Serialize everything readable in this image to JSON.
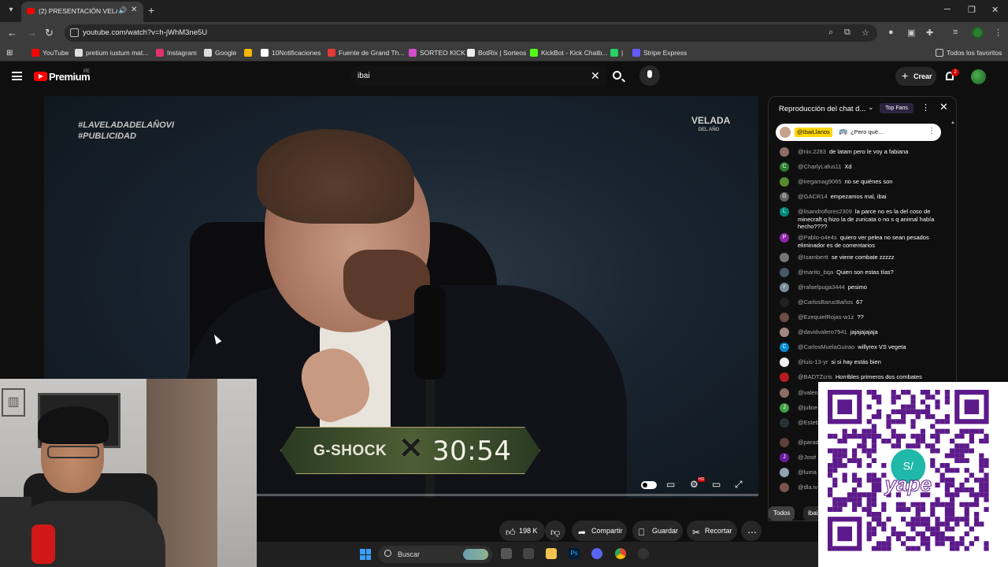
{
  "browser": {
    "tab_title": "(2) PRESENTACIÓN VELADA...",
    "url": "youtube.com/watch?v=h-jWhM3ne5U",
    "bookmarks": [
      {
        "label": "YouTube",
        "color": "#ff0000"
      },
      {
        "label": "pretium iustum mat...",
        "color": "#dddddd"
      },
      {
        "label": "Instagram",
        "color": "#e1306c"
      },
      {
        "label": "Google",
        "color": "#dddddd"
      },
      {
        "label": "",
        "color": "#f4b400"
      },
      {
        "label": "10Notificaciones",
        "color": "#ffffff"
      },
      {
        "label": "Fuente de Grand Th...",
        "color": "#e53935"
      },
      {
        "label": "SORTEO KICK",
        "color": "#d34dc9"
      },
      {
        "label": "BotRix | Sorteos",
        "color": "#eeeeee"
      },
      {
        "label": "KickBot - Kick Chatb...",
        "color": "#53fc18"
      },
      {
        "label": "|",
        "color": "#25d366"
      },
      {
        "label": "Stripe Express",
        "color": "#635bff"
      }
    ],
    "all_favorites": "Todos los favoritos"
  },
  "youtube": {
    "brand": "Premium",
    "country": "PE",
    "search_query": "ibai",
    "create_label": "Crear",
    "notif_count": "2"
  },
  "video": {
    "hashtag1": "#LAVELADADELAÑOVI",
    "hashtag2": "#PUBLICIDAD",
    "logo_top": "VELADA",
    "logo_bottom": "DEL AÑO",
    "sponsor": "G-SHOCK",
    "countdown": "30:54",
    "progress": 0.0
  },
  "actions": {
    "likes": "198 K",
    "share": "Compartir",
    "save": "Guardar",
    "clip": "Recortar"
  },
  "chat": {
    "title": "Reproducción del chat d...",
    "top_fans": "Top Fans",
    "pinned": {
      "author": "@IbaiLlanos",
      "message": "¿Pero qué..."
    },
    "messages": [
      {
        "author": "@nix.2283",
        "text": "de latam pero le voy a fabiana",
        "av": "",
        "color": "#8d6e63"
      },
      {
        "author": "@CharlyLafus11",
        "text": "Xd",
        "av": "C",
        "color": "#2e7d32"
      },
      {
        "author": "@iregamag9065",
        "text": "no se quiénes son",
        "av": "",
        "color": "#558b2f"
      },
      {
        "author": "@GACR14",
        "text": "empezamos mal, ibai",
        "av": "G",
        "color": "#616161"
      },
      {
        "author": "@lisandroflores2309",
        "text": "la parce no es la del coso de minecraft q hizo la de zuricata o no s q animal había hecho????",
        "av": "L",
        "color": "#00897b"
      },
      {
        "author": "@Pablo-o4e4s",
        "text": "quiero ver pelea no sean pesados eliminador es de comentarios",
        "av": "P",
        "color": "#8e24aa"
      },
      {
        "author": "@Isambertt",
        "text": "se viene combate zzzzz",
        "av": "",
        "color": "#757575"
      },
      {
        "author": "@marito_bqa",
        "text": "Quien son estas tías?",
        "av": "",
        "color": "#455a64"
      },
      {
        "author": "@rafaelpuga3444",
        "text": "pesimo",
        "av": "r",
        "color": "#78909c"
      },
      {
        "author": "@CarlosBarucBaños",
        "text": "67",
        "av": "",
        "color": "#212121"
      },
      {
        "author": "@EzequielRojas-w1z",
        "text": "??",
        "av": "",
        "color": "#6d4c41"
      },
      {
        "author": "@davidvalero7941",
        "text": "jajajajajaja",
        "av": "",
        "color": "#a1887f"
      },
      {
        "author": "@CarlosMuelaGuirao",
        "text": "willyrex VS vegeta",
        "av": "C",
        "color": "#0288d1"
      },
      {
        "author": "@luis-13-yr",
        "text": "si si hay estás bien",
        "av": "",
        "color": "#eeeeee"
      },
      {
        "author": "@BADTZcris",
        "text": "Horribles primeros dos combates",
        "av": "",
        "color": "#b71c1c"
      },
      {
        "author": "@valen",
        "text": "",
        "av": "",
        "color": "#8d6e63"
      },
      {
        "author": "@julioe",
        "text": "",
        "av": "J",
        "color": "#43a047"
      },
      {
        "author": "@Esteb",
        "text": "colomb",
        "av": "",
        "color": "#263238"
      },
      {
        "author": "@parad",
        "text": "",
        "av": "",
        "color": "#5d4037"
      },
      {
        "author": "@José",
        "text": "",
        "av": "J",
        "color": "#6a1b9a"
      },
      {
        "author": "@luma",
        "text": "",
        "av": "",
        "color": "#90a4ae"
      },
      {
        "author": "@dla.iv",
        "text": "",
        "av": "",
        "color": "#795548"
      }
    ],
    "chips": [
      "Todos",
      "ibai"
    ]
  },
  "qr": {
    "brand": "yape",
    "currency": "S/",
    "color": "#5c1a8a"
  },
  "taskbar": {
    "search_label": "Buscar"
  }
}
